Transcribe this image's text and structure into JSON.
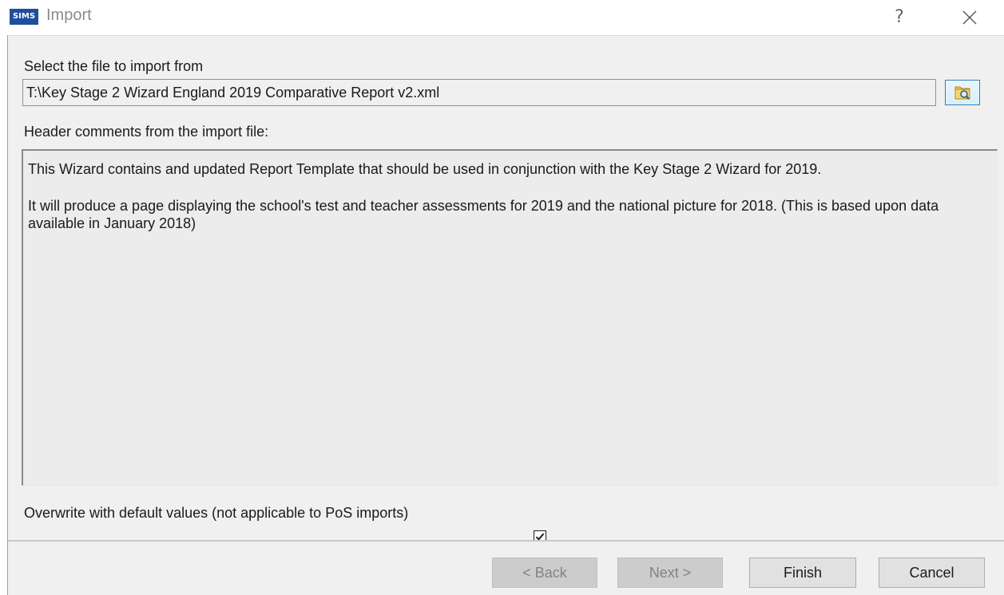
{
  "window": {
    "app_logo": "SIMS",
    "title": "Import",
    "help_label": "?"
  },
  "import": {
    "file_label": "Select the file to import from",
    "file_path": "T:\\Key Stage 2 Wizard England 2019 Comparative Report v2.xml",
    "comments_label": "Header comments from the import file:",
    "comments": [
      "This Wizard contains and updated Report Template that should be used in conjunction with the Key Stage 2 Wizard for 2019.",
      "It will produce a page displaying the school's test and teacher assessments for 2019 and the national picture for 2018. (This is based upon data available in January 2018)"
    ],
    "overwrite_label": "Overwrite with default values (not applicable to PoS imports)",
    "overwrite_checked": true
  },
  "buttons": {
    "back": "< Back",
    "next": "Next >",
    "finish": "Finish",
    "cancel": "Cancel"
  },
  "icons": {
    "browse": "folder-search-icon",
    "close": "close-icon",
    "check": "checkmark-icon"
  }
}
